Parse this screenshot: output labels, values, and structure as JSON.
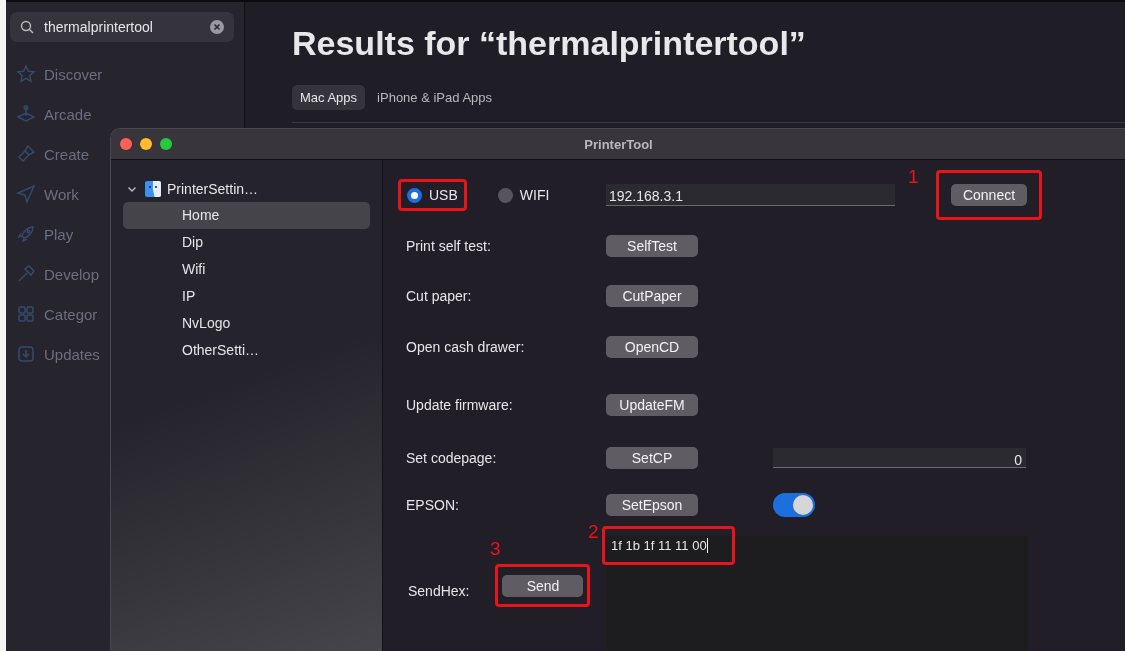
{
  "store": {
    "search": {
      "value": "thermalprintertool"
    },
    "nav": [
      {
        "label": "Discover",
        "kind": "star"
      },
      {
        "label": "Arcade",
        "kind": "joystick"
      },
      {
        "label": "Create",
        "kind": "brush"
      },
      {
        "label": "Work",
        "kind": "plane"
      },
      {
        "label": "Play",
        "kind": "rocket"
      },
      {
        "label": "Develop",
        "kind": "hammer"
      },
      {
        "label": "Categor",
        "kind": "grid"
      },
      {
        "label": "Updates",
        "kind": "download"
      }
    ],
    "heading": "Results for “thermalprintertool”",
    "tabs": [
      {
        "label": "Mac Apps",
        "selected": true
      },
      {
        "label": "iPhone & iPad Apps",
        "selected": false
      }
    ]
  },
  "window": {
    "title": "PrinterTool",
    "sidebar": {
      "label": "PrinterSettin…",
      "expanded": true,
      "children": [
        {
          "label": "Home",
          "selected": true
        },
        {
          "label": "Dip",
          "selected": false
        },
        {
          "label": "Wifi",
          "selected": false
        },
        {
          "label": "IP",
          "selected": false
        },
        {
          "label": "NvLogo",
          "selected": false
        },
        {
          "label": "OtherSetti…",
          "selected": false
        }
      ]
    },
    "connection": {
      "options": [
        {
          "label": "USB",
          "selected": true,
          "annotated": true
        },
        {
          "label": "WIFI",
          "selected": false,
          "annotated": false
        }
      ],
      "ip": "192.168.3.1",
      "button": "Connect",
      "annotation": "1"
    },
    "rows": [
      {
        "kind": "button",
        "label": "Print self test:",
        "button": "SelfTest"
      },
      {
        "kind": "button",
        "label": "Cut paper:",
        "button": "CutPaper"
      },
      {
        "kind": "button",
        "label": "Open cash drawer:",
        "button": "OpenCD"
      },
      {
        "kind": "button",
        "label": "Update firmware:",
        "button": "UpdateFM"
      },
      {
        "kind": "field",
        "label": "Set codepage:",
        "button": "SetCP",
        "value": "0"
      },
      {
        "kind": "toggle",
        "label": "EPSON:",
        "button": "SetEpson",
        "on": true
      }
    ],
    "sendhex": {
      "label": "SendHex:",
      "button": "Send",
      "button_annotation": "3",
      "value": "1f 1b 1f 11 11 00",
      "value_annotation": "2"
    }
  }
}
